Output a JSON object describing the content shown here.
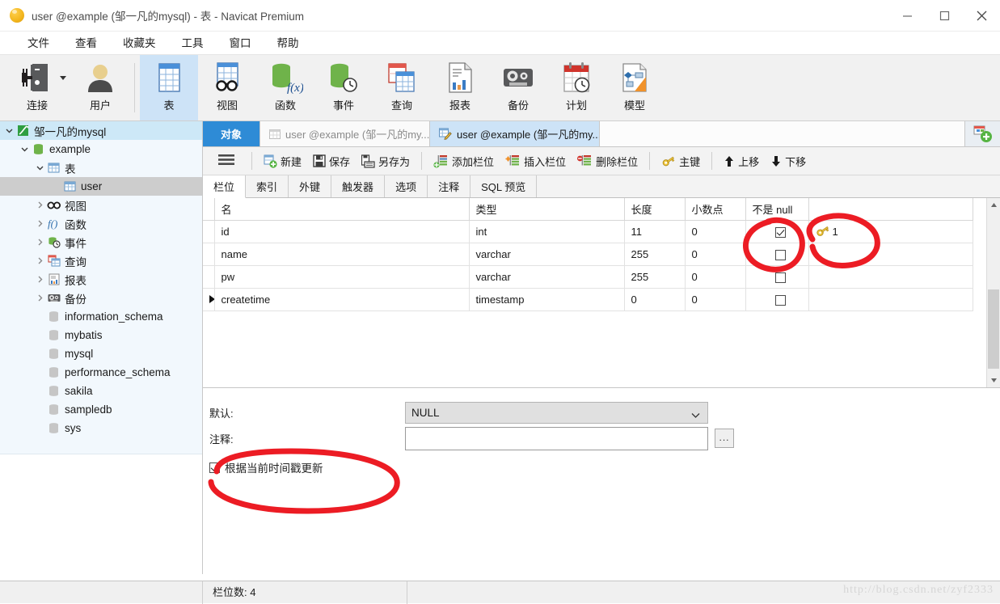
{
  "window": {
    "title": "user @example (邹一凡的mysql) - 表 - Navicat Premium",
    "app_icon": "navicat-icon",
    "minimize": "minimize-icon",
    "maximize": "maximize-icon",
    "close": "close-icon"
  },
  "menubar": {
    "items": [
      {
        "label": "文件"
      },
      {
        "label": "查看"
      },
      {
        "label": "收藏夹"
      },
      {
        "label": "工具"
      },
      {
        "label": "窗口"
      },
      {
        "label": "帮助"
      }
    ]
  },
  "ribbon": {
    "items": [
      {
        "label": "连接",
        "icon": "connection-icon",
        "active": false,
        "dropdown": true
      },
      {
        "label": "用户",
        "icon": "user-icon",
        "active": false
      },
      {
        "label": "表",
        "icon": "table-icon",
        "active": true
      },
      {
        "label": "视图",
        "icon": "view-icon",
        "active": false
      },
      {
        "label": "函数",
        "icon": "function-icon",
        "active": false
      },
      {
        "label": "事件",
        "icon": "event-icon",
        "active": false
      },
      {
        "label": "查询",
        "icon": "query-icon",
        "active": false
      },
      {
        "label": "报表",
        "icon": "report-icon",
        "active": false
      },
      {
        "label": "备份",
        "icon": "backup-icon",
        "active": false
      },
      {
        "label": "计划",
        "icon": "schedule-icon",
        "active": false
      },
      {
        "label": "模型",
        "icon": "model-icon",
        "active": false
      }
    ]
  },
  "sidebar": {
    "items": [
      {
        "label": "邹一凡的mysql",
        "indent": 0,
        "twisty": "down",
        "icon": "connection-leaf-icon",
        "state": "selected-blue"
      },
      {
        "label": "example",
        "indent": 1,
        "twisty": "down",
        "icon": "database-green-icon",
        "state": ""
      },
      {
        "label": "表",
        "indent": 2,
        "twisty": "down",
        "icon": "table-icon",
        "state": ""
      },
      {
        "label": "user",
        "indent": 3,
        "twisty": "none",
        "icon": "table-icon",
        "state": "selected-gray"
      },
      {
        "label": "视图",
        "indent": 2,
        "twisty": "right",
        "icon": "view-icon",
        "state": ""
      },
      {
        "label": "函数",
        "indent": 2,
        "twisty": "right",
        "icon": "function-icon",
        "state": ""
      },
      {
        "label": "事件",
        "indent": 2,
        "twisty": "right",
        "icon": "event-icon",
        "state": ""
      },
      {
        "label": "查询",
        "indent": 2,
        "twisty": "right",
        "icon": "query-icon",
        "state": ""
      },
      {
        "label": "报表",
        "indent": 2,
        "twisty": "right",
        "icon": "report-icon",
        "state": ""
      },
      {
        "label": "备份",
        "indent": 2,
        "twisty": "right",
        "icon": "backup-icon",
        "state": ""
      },
      {
        "label": "information_schema",
        "indent": 1,
        "twisty": "none",
        "icon": "database-gray-icon",
        "state": ""
      },
      {
        "label": "mybatis",
        "indent": 1,
        "twisty": "none",
        "icon": "database-gray-icon",
        "state": ""
      },
      {
        "label": "mysql",
        "indent": 1,
        "twisty": "none",
        "icon": "database-gray-icon",
        "state": ""
      },
      {
        "label": "performance_schema",
        "indent": 1,
        "twisty": "none",
        "icon": "database-gray-icon",
        "state": ""
      },
      {
        "label": "sakila",
        "indent": 1,
        "twisty": "none",
        "icon": "database-gray-icon",
        "state": ""
      },
      {
        "label": "sampledb",
        "indent": 1,
        "twisty": "none",
        "icon": "database-gray-icon",
        "state": ""
      },
      {
        "label": "sys",
        "indent": 1,
        "twisty": "none",
        "icon": "database-gray-icon",
        "state": ""
      }
    ]
  },
  "tabstrip": {
    "objects_tab": "对象",
    "tabs": [
      {
        "label": "user @example (邹一凡的my...",
        "icon": "table-icon",
        "active": false
      },
      {
        "label": "user @example (邹一凡的my...",
        "icon": "table-design-icon",
        "active": true
      }
    ],
    "add_tab": "new-tab-icon"
  },
  "editor_toolbar": {
    "menu_icon": "hamburger-icon",
    "buttons": [
      {
        "label": "新建",
        "icon": "new-field-icon"
      },
      {
        "label": "保存",
        "icon": "save-icon"
      },
      {
        "label": "另存为",
        "icon": "save-as-icon"
      },
      {
        "label": "添加栏位",
        "icon": "add-field-icon"
      },
      {
        "label": "插入栏位",
        "icon": "insert-field-icon"
      },
      {
        "label": "删除栏位",
        "icon": "delete-field-icon"
      },
      {
        "label": "主键",
        "icon": "primary-key-icon"
      },
      {
        "label": "上移",
        "icon": "move-up-icon"
      },
      {
        "label": "下移",
        "icon": "move-down-icon"
      }
    ]
  },
  "subtabs": {
    "items": [
      {
        "label": "栏位",
        "active": true
      },
      {
        "label": "索引",
        "active": false
      },
      {
        "label": "外键",
        "active": false
      },
      {
        "label": "触发器",
        "active": false
      },
      {
        "label": "选项",
        "active": false
      },
      {
        "label": "注释",
        "active": false
      },
      {
        "label": "SQL 预览",
        "active": false
      }
    ]
  },
  "grid": {
    "columns": [
      "名",
      "类型",
      "长度",
      "小数点",
      "不是 null",
      ""
    ],
    "rows": [
      {
        "marker": "",
        "name": "id",
        "type": "int",
        "length": "11",
        "decimals": "0",
        "notnull": true,
        "pk": "1"
      },
      {
        "marker": "",
        "name": "name",
        "type": "varchar",
        "length": "255",
        "decimals": "0",
        "notnull": false,
        "pk": ""
      },
      {
        "marker": "",
        "name": "pw",
        "type": "varchar",
        "length": "255",
        "decimals": "0",
        "notnull": false,
        "pk": ""
      },
      {
        "marker": "▶",
        "name": "createtime",
        "type": "timestamp",
        "length": "0",
        "decimals": "0",
        "notnull": false,
        "pk": ""
      }
    ]
  },
  "form": {
    "default_label": "默认:",
    "default_value": "NULL",
    "comment_label": "注释:",
    "comment_value": "",
    "comment_browse": "...",
    "update_on_timestamp_label": "根据当前时间戳更新",
    "update_on_timestamp_checked": true
  },
  "statusbar": {
    "field_count": "栏位数: 4",
    "watermark": "http://blog.csdn.net/zyf2333"
  },
  "colors": {
    "accent_blue": "#2e8bd6",
    "tab_active": "#cde3f7",
    "sidebar_bg": "#f2f8fd",
    "annotation_red": "#ec1c24",
    "key_gold": "#e8b830"
  }
}
